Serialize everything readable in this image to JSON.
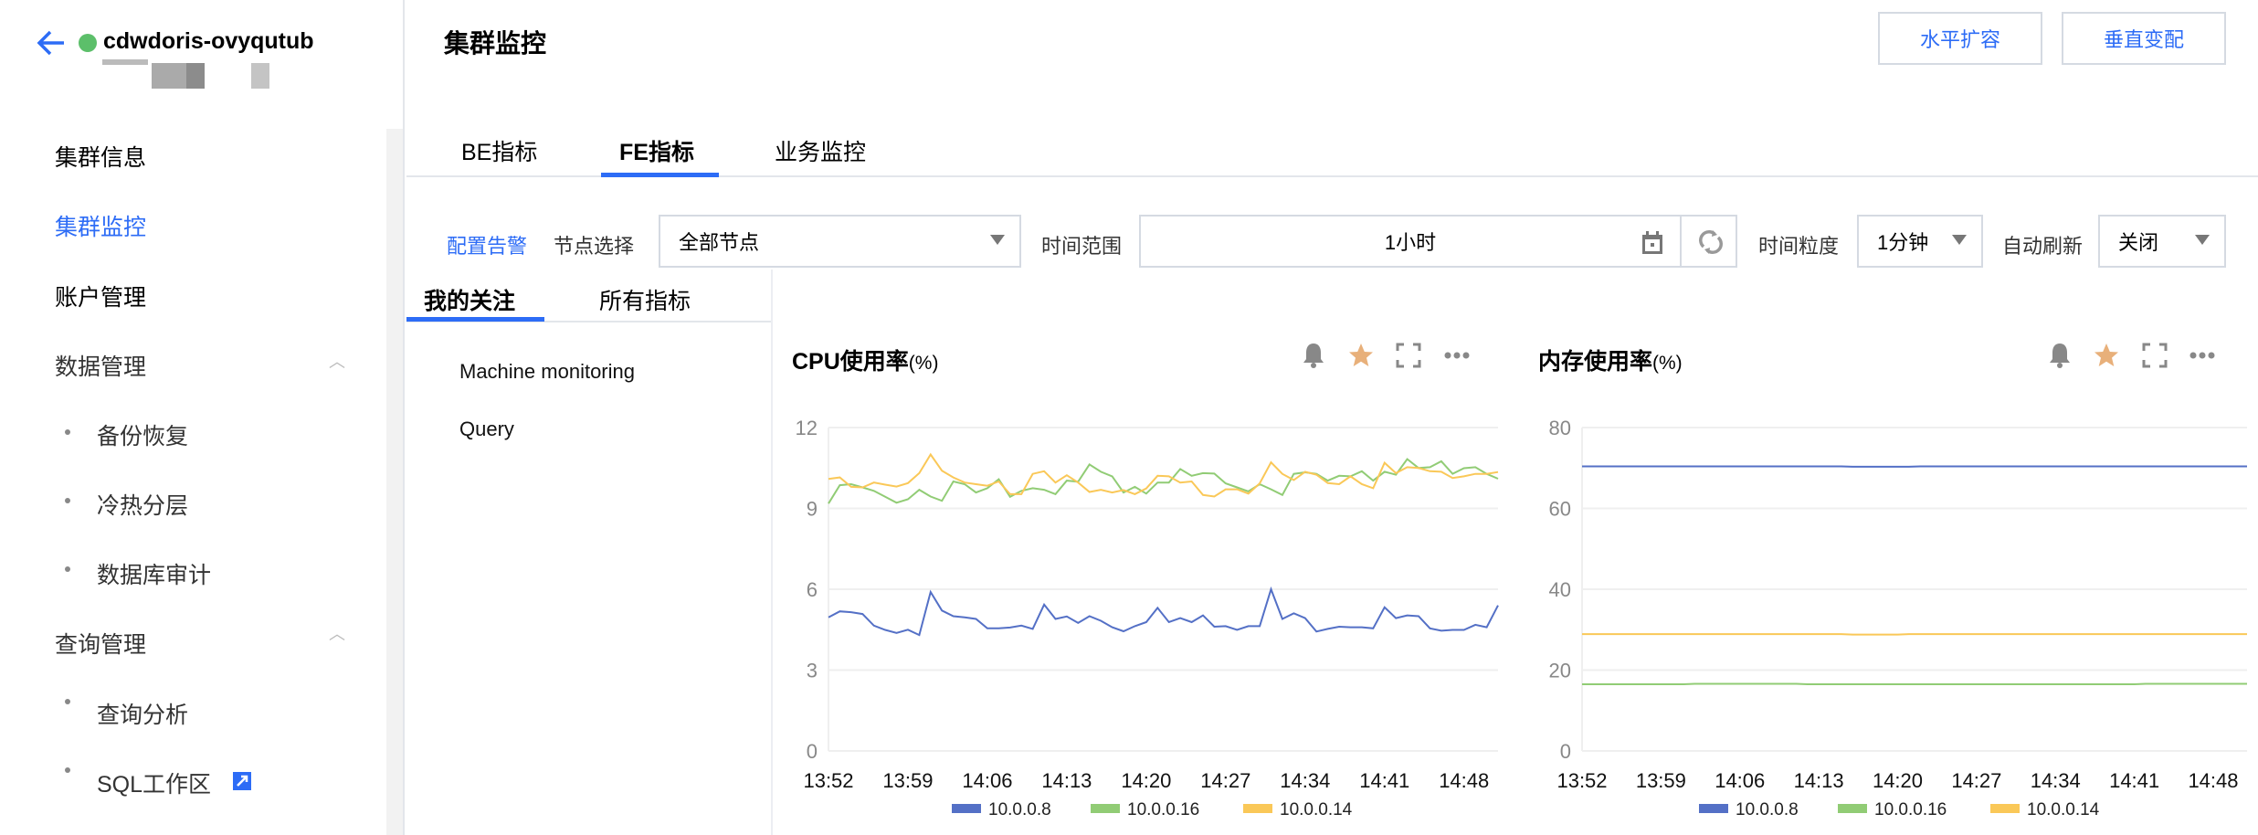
{
  "sidebar": {
    "cluster_name": "cdwdoris-ovyqutub",
    "status_color": "#5cbf6a",
    "items": [
      {
        "label": "集群信息",
        "active": false
      },
      {
        "label": "集群监控",
        "active": true
      },
      {
        "label": "账户管理",
        "active": false
      },
      {
        "label": "数据管理",
        "expanded": true,
        "children": [
          {
            "label": "备份恢复"
          },
          {
            "label": "冷热分层"
          },
          {
            "label": "数据库审计"
          }
        ]
      },
      {
        "label": "查询管理",
        "expanded": true,
        "children": [
          {
            "label": "查询分析"
          },
          {
            "label": "SQL工作区",
            "icon": "external-link-icon"
          }
        ]
      }
    ]
  },
  "header": {
    "title": "集群监控",
    "buttons": [
      {
        "label": "水平扩容"
      },
      {
        "label": "垂直变配"
      }
    ]
  },
  "tabs": [
    {
      "label": "BE指标"
    },
    {
      "label": "FE指标",
      "active": true
    },
    {
      "label": "业务监控"
    }
  ],
  "filters": {
    "alert_link": "配置告警",
    "node_label": "节点选择",
    "node_value": "全部节点",
    "range_label": "时间范围",
    "range_value": "1小时",
    "granularity_label": "时间粒度",
    "granularity_value": "1分钟",
    "refresh_label": "自动刷新",
    "refresh_value": "关闭"
  },
  "subtabs": [
    {
      "label": "我的关注",
      "active": true
    },
    {
      "label": "所有指标"
    }
  ],
  "metric_groups": [
    {
      "label": "Machine monitoring"
    },
    {
      "label": "Query"
    }
  ],
  "colors": {
    "accent": "#2d6cf6",
    "series": [
      "#5470c6",
      "#91cc75",
      "#fac858"
    ],
    "star": "#e8b07a"
  },
  "chart_data": [
    {
      "type": "line",
      "title": "CPU使用率",
      "unit": "(%)",
      "ylim": [
        0,
        12
      ],
      "yticks": [
        "0",
        "3",
        "6",
        "9",
        "12"
      ],
      "xticks": [
        "13:52",
        "13:59",
        "14:06",
        "14:13",
        "14:20",
        "14:27",
        "14:34",
        "14:41",
        "14:48"
      ],
      "grid": true,
      "legend": "bottom",
      "x": [
        "13:52",
        "13:53",
        "13:54",
        "13:55",
        "13:56",
        "13:57",
        "13:58",
        "13:59",
        "14:00",
        "14:01",
        "14:02",
        "14:03",
        "14:04",
        "14:05",
        "14:06",
        "14:07",
        "14:08",
        "14:09",
        "14:10",
        "14:11",
        "14:12",
        "14:13",
        "14:14",
        "14:15",
        "14:16",
        "14:17",
        "14:18",
        "14:19",
        "14:20",
        "14:21",
        "14:22",
        "14:23",
        "14:24",
        "14:25",
        "14:26",
        "14:27",
        "14:28",
        "14:29",
        "14:30",
        "14:31",
        "14:32",
        "14:33",
        "14:34",
        "14:35",
        "14:36",
        "14:37",
        "14:38",
        "14:39",
        "14:40",
        "14:41",
        "14:42",
        "14:43",
        "14:44",
        "14:45",
        "14:46",
        "14:47",
        "14:48",
        "14:49",
        "14:50",
        "14:51"
      ],
      "series": [
        {
          "name": "10.0.0.8",
          "values": [
            4.96,
            5.18,
            5.15,
            5.08,
            4.65,
            4.49,
            4.38,
            4.5,
            4.3,
            5.9,
            5.21,
            5.0,
            4.96,
            4.9,
            4.55,
            4.55,
            4.58,
            4.65,
            4.53,
            5.43,
            4.9,
            4.99,
            4.75,
            5.0,
            4.83,
            4.59,
            4.44,
            4.63,
            4.78,
            5.31,
            4.78,
            4.93,
            4.78,
            5.03,
            4.61,
            4.63,
            4.49,
            4.63,
            4.63,
            6.0,
            4.9,
            5.11,
            4.93,
            4.43,
            4.53,
            4.61,
            4.59,
            4.59,
            4.55,
            5.33,
            4.93,
            5.03,
            5.0,
            4.55,
            4.46,
            4.49,
            4.49,
            4.68,
            4.59,
            5.4
          ]
        },
        {
          "name": "10.0.0.16",
          "values": [
            9.18,
            9.86,
            9.9,
            9.78,
            9.65,
            9.43,
            9.21,
            9.34,
            9.69,
            9.44,
            9.28,
            10.0,
            9.9,
            9.59,
            9.75,
            10.08,
            9.43,
            9.65,
            9.75,
            9.69,
            9.53,
            10.03,
            9.99,
            10.63,
            10.36,
            10.19,
            9.59,
            9.8,
            9.55,
            9.96,
            9.96,
            10.46,
            10.21,
            10.31,
            10.29,
            9.93,
            9.78,
            9.63,
            9.9,
            9.71,
            9.5,
            10.28,
            10.34,
            10.28,
            10.03,
            10.21,
            10.19,
            10.38,
            10.03,
            10.36,
            10.25,
            10.83,
            10.5,
            10.53,
            10.75,
            10.28,
            10.49,
            10.53,
            10.28,
            10.1
          ]
        },
        {
          "name": "10.0.0.14",
          "values": [
            10.09,
            10.15,
            9.8,
            9.78,
            9.96,
            9.88,
            9.81,
            9.94,
            10.31,
            11.0,
            10.4,
            10.15,
            9.96,
            9.9,
            9.84,
            10.0,
            9.53,
            9.53,
            10.28,
            10.38,
            9.96,
            10.23,
            9.96,
            9.61,
            9.69,
            9.59,
            9.68,
            9.53,
            9.74,
            10.21,
            10.19,
            9.96,
            10.0,
            9.5,
            9.44,
            9.71,
            9.71,
            9.55,
            9.93,
            10.71,
            10.28,
            10.05,
            10.36,
            10.25,
            9.94,
            9.9,
            10.19,
            9.9,
            9.75,
            10.69,
            10.31,
            10.53,
            10.5,
            10.38,
            10.36,
            10.13,
            10.19,
            10.28,
            10.28,
            10.35
          ]
        }
      ]
    },
    {
      "type": "line",
      "title": "内存使用率",
      "unit": "(%)",
      "ylim": [
        0,
        80
      ],
      "yticks": [
        "0",
        "20",
        "40",
        "60",
        "80"
      ],
      "xticks": [
        "13:52",
        "13:59",
        "14:06",
        "14:13",
        "14:20",
        "14:27",
        "14:34",
        "14:41",
        "14:48"
      ],
      "grid": true,
      "legend": "bottom",
      "x": [
        "13:52",
        "13:53",
        "13:54",
        "13:55",
        "13:56",
        "13:57",
        "13:58",
        "13:59",
        "14:00",
        "14:01",
        "14:02",
        "14:03",
        "14:04",
        "14:05",
        "14:06",
        "14:07",
        "14:08",
        "14:09",
        "14:10",
        "14:11",
        "14:12",
        "14:13",
        "14:14",
        "14:15",
        "14:16",
        "14:17",
        "14:18",
        "14:19",
        "14:20",
        "14:21",
        "14:22",
        "14:23",
        "14:24",
        "14:25",
        "14:26",
        "14:27",
        "14:28",
        "14:29",
        "14:30",
        "14:31",
        "14:32",
        "14:33",
        "14:34",
        "14:35",
        "14:36",
        "14:37",
        "14:38",
        "14:39",
        "14:40",
        "14:41",
        "14:42",
        "14:43",
        "14:44",
        "14:45",
        "14:46",
        "14:47",
        "14:48",
        "14:49",
        "14:50",
        "14:51"
      ],
      "series": [
        {
          "name": "10.0.0.8",
          "values": [
            70.4,
            70.4,
            70.4,
            70.4,
            70.4,
            70.4,
            70.4,
            70.4,
            70.4,
            70.4,
            70.4,
            70.4,
            70.4,
            70.4,
            70.4,
            70.4,
            70.4,
            70.4,
            70.4,
            70.4,
            70.4,
            70.4,
            70.4,
            70.4,
            70.3,
            70.3,
            70.3,
            70.3,
            70.3,
            70.3,
            70.4,
            70.4,
            70.4,
            70.4,
            70.4,
            70.4,
            70.4,
            70.4,
            70.4,
            70.4,
            70.4,
            70.4,
            70.4,
            70.4,
            70.4,
            70.4,
            70.4,
            70.4,
            70.4,
            70.4,
            70.4,
            70.4,
            70.4,
            70.4,
            70.4,
            70.4,
            70.4,
            70.4,
            70.4,
            70.4
          ]
        },
        {
          "name": "10.0.0.16",
          "values": [
            16.5,
            16.5,
            16.5,
            16.5,
            16.5,
            16.5,
            16.5,
            16.5,
            16.5,
            16.5,
            16.6,
            16.6,
            16.6,
            16.6,
            16.6,
            16.6,
            16.6,
            16.6,
            16.6,
            16.6,
            16.5,
            16.5,
            16.5,
            16.5,
            16.5,
            16.5,
            16.5,
            16.5,
            16.5,
            16.5,
            16.5,
            16.5,
            16.5,
            16.5,
            16.5,
            16.5,
            16.5,
            16.5,
            16.5,
            16.5,
            16.5,
            16.5,
            16.5,
            16.5,
            16.5,
            16.5,
            16.5,
            16.5,
            16.5,
            16.5,
            16.6,
            16.6,
            16.6,
            16.6,
            16.6,
            16.6,
            16.6,
            16.6,
            16.6,
            16.6
          ]
        },
        {
          "name": "10.0.0.14",
          "values": [
            28.9,
            28.9,
            28.9,
            28.9,
            28.9,
            28.9,
            28.9,
            28.9,
            28.9,
            28.9,
            28.9,
            28.9,
            28.9,
            28.9,
            28.9,
            28.9,
            28.9,
            28.9,
            28.9,
            28.9,
            28.9,
            28.9,
            28.9,
            28.9,
            28.8,
            28.8,
            28.8,
            28.8,
            28.8,
            28.9,
            28.9,
            28.9,
            28.9,
            28.9,
            28.9,
            28.9,
            28.9,
            28.9,
            28.9,
            28.9,
            28.9,
            28.9,
            28.9,
            28.9,
            28.9,
            28.9,
            28.9,
            28.9,
            28.9,
            28.9,
            28.9,
            28.9,
            28.9,
            28.9,
            28.9,
            28.9,
            28.9,
            28.9,
            28.9,
            28.9
          ]
        }
      ]
    }
  ]
}
